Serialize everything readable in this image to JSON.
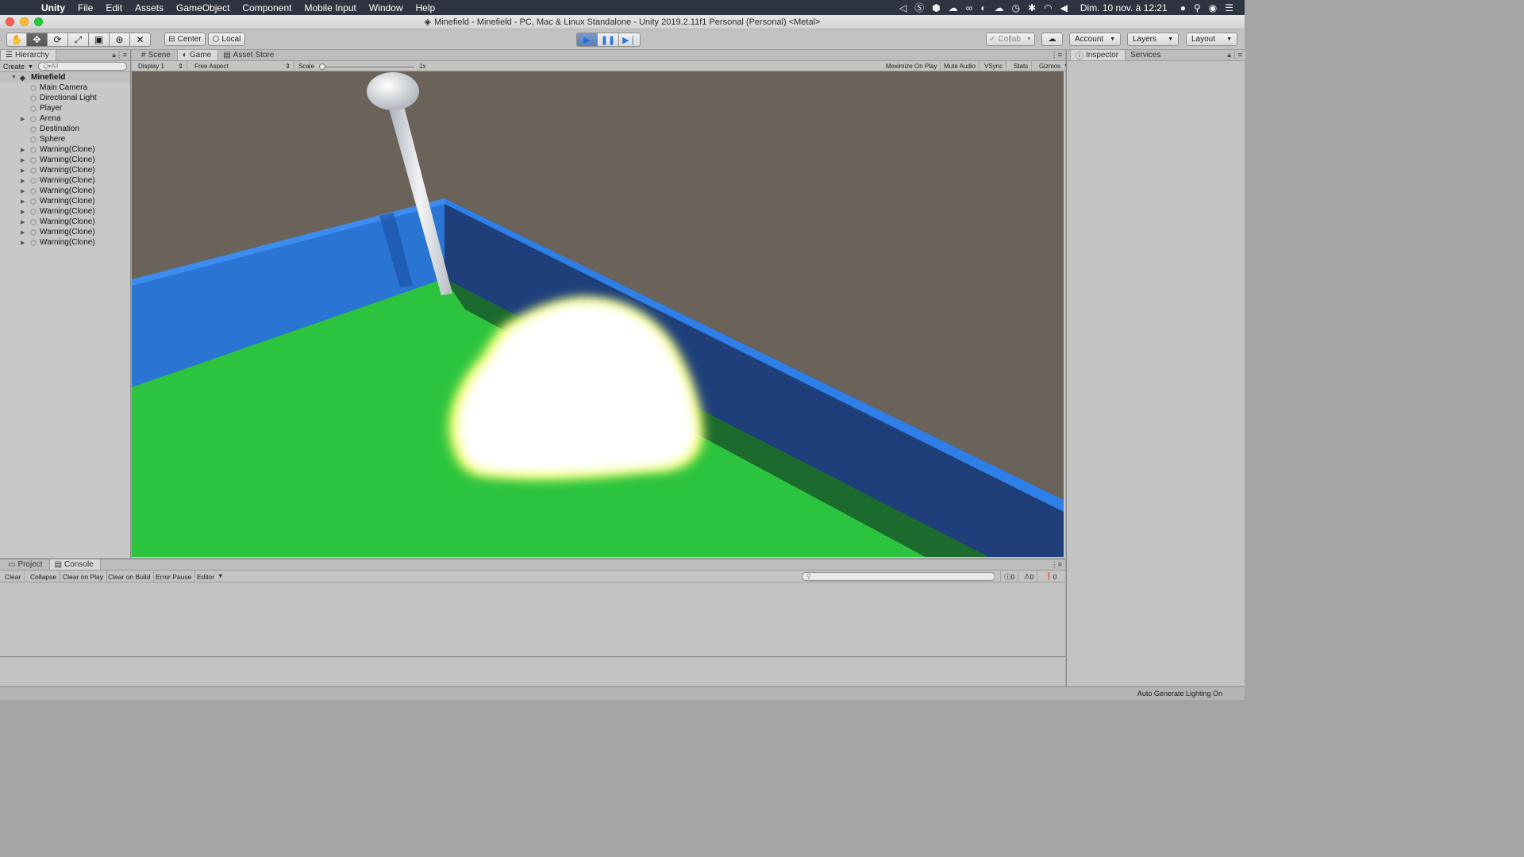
{
  "menubar": {
    "app_name": "Unity",
    "items": [
      "File",
      "Edit",
      "Assets",
      "GameObject",
      "Component",
      "Mobile Input",
      "Window",
      "Help"
    ],
    "clock": "Dim. 10 nov. à 12:21"
  },
  "window": {
    "title": "Minefield - Minefield - PC, Mac & Linux Standalone - Unity 2019.2.11f1 Personal (Personal) <Metal>"
  },
  "toolbar": {
    "pivot_label": "Center",
    "space_label": "Local",
    "collab_label": "Collab",
    "account_label": "Account",
    "layers_label": "Layers",
    "layout_label": "Layout"
  },
  "hierarchy": {
    "tab_label": "Hierarchy",
    "create_label": "Create",
    "search_placeholder": "Q▾All",
    "root": "Minefield",
    "items": [
      {
        "label": "Main Camera",
        "expandable": false
      },
      {
        "label": "Directional Light",
        "expandable": false
      },
      {
        "label": "Player",
        "expandable": false
      },
      {
        "label": "Arena",
        "expandable": true
      },
      {
        "label": "Destination",
        "expandable": false
      },
      {
        "label": "Sphere",
        "expandable": false
      },
      {
        "label": "Warning(Clone)",
        "expandable": true
      },
      {
        "label": "Warning(Clone)",
        "expandable": true
      },
      {
        "label": "Warning(Clone)",
        "expandable": true
      },
      {
        "label": "Warning(Clone)",
        "expandable": true
      },
      {
        "label": "Warning(Clone)",
        "expandable": true
      },
      {
        "label": "Warning(Clone)",
        "expandable": true
      },
      {
        "label": "Warning(Clone)",
        "expandable": true
      },
      {
        "label": "Warning(Clone)",
        "expandable": true
      },
      {
        "label": "Warning(Clone)",
        "expandable": true
      },
      {
        "label": "Warning(Clone)",
        "expandable": true
      }
    ]
  },
  "center_tabs": {
    "scene": "Scene",
    "game": "Game",
    "asset_store": "Asset Store"
  },
  "gamebar": {
    "display": "Display 1",
    "aspect": "Free Aspect",
    "scale_label": "Scale",
    "scale_value": "1x",
    "maximize": "Maximize On Play",
    "mute": "Mute Audio",
    "vsync": "VSync",
    "stats": "Stats",
    "gizmos": "Gizmos"
  },
  "right_tabs": {
    "inspector": "Inspector",
    "services": "Services"
  },
  "bottom_tabs": {
    "project": "Project",
    "console": "Console"
  },
  "consolebar": {
    "clear": "Clear",
    "collapse": "Collapse",
    "clear_on_play": "Clear on Play",
    "clear_on_build": "Clear on Build",
    "error_pause": "Error Pause",
    "editor": "Editor",
    "log_count": "0",
    "warn_count": "0",
    "error_count": "0"
  },
  "statusbar": {
    "text": "Auto Generate Lighting On"
  },
  "colors": {
    "ground": "#2cc43e",
    "wall": "#2f78d8",
    "sky": "#6b625a"
  }
}
